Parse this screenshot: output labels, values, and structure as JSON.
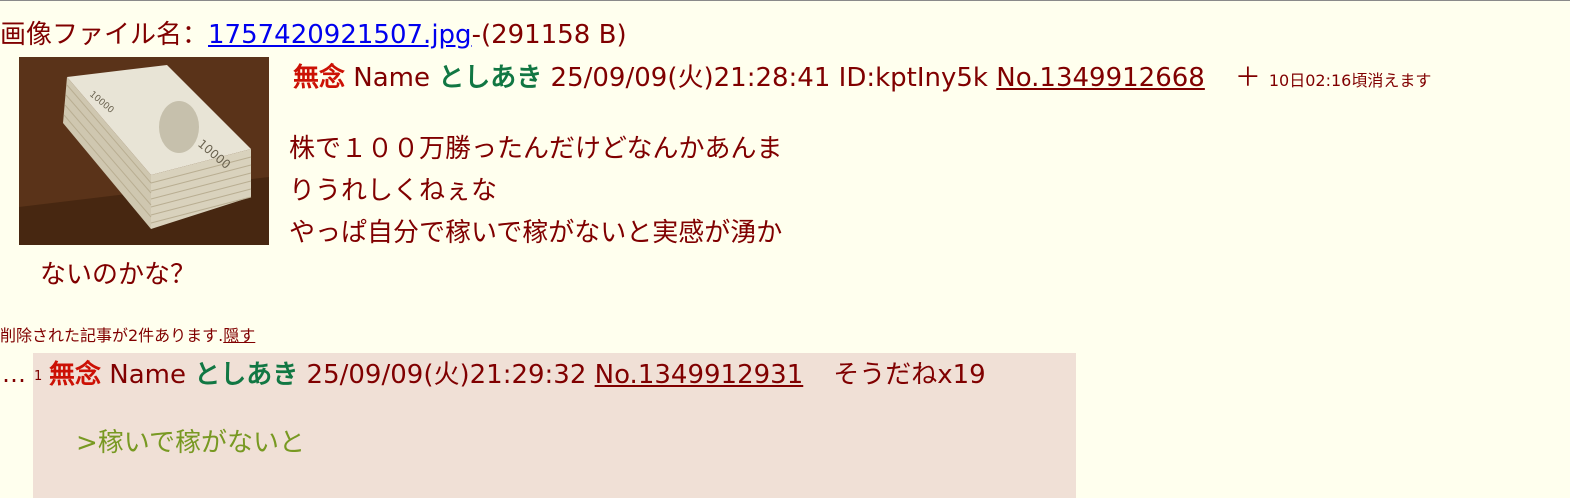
{
  "file": {
    "label": "画像ファイル名：",
    "filename": "1757420921507.jpg",
    "size": "-(291158 B)"
  },
  "thumbnail": {
    "icon": "banknote-stack-image"
  },
  "op": {
    "subject": "無念",
    "name_label": "Name",
    "name": "としあき",
    "datetime": "25/09/09(火)21:28:41",
    "id": "ID:kptIny5k",
    "number": "No.1349912668",
    "plus": "＋",
    "expire": "10日02:16頃消えます",
    "body": [
      "株で１００万勝ったんだけどなんかあんま",
      "りうれしくねぇな",
      "やっぱ自分で稼いで稼がないと実感が湧か"
    ],
    "body_tail": "ないのかな？"
  },
  "deleted": {
    "text": "削除された記事が2件あります.",
    "hide_link": "隠す"
  },
  "reply": {
    "marker": "…",
    "index": "1",
    "subject": "無念",
    "name_label": "Name",
    "name": "としあき",
    "datetime": "25/09/09(火)21:29:32",
    "number": "No.1349912931",
    "soudane": "そうだねx19",
    "quote": ">稼いで稼がないと"
  },
  "colors": {
    "background": "#ffffee",
    "text": "#800000",
    "subject": "#cc1105",
    "name": "#117743",
    "reply_bg": "#f0e0d6",
    "quote": "#789922",
    "link": "#0000ee"
  }
}
